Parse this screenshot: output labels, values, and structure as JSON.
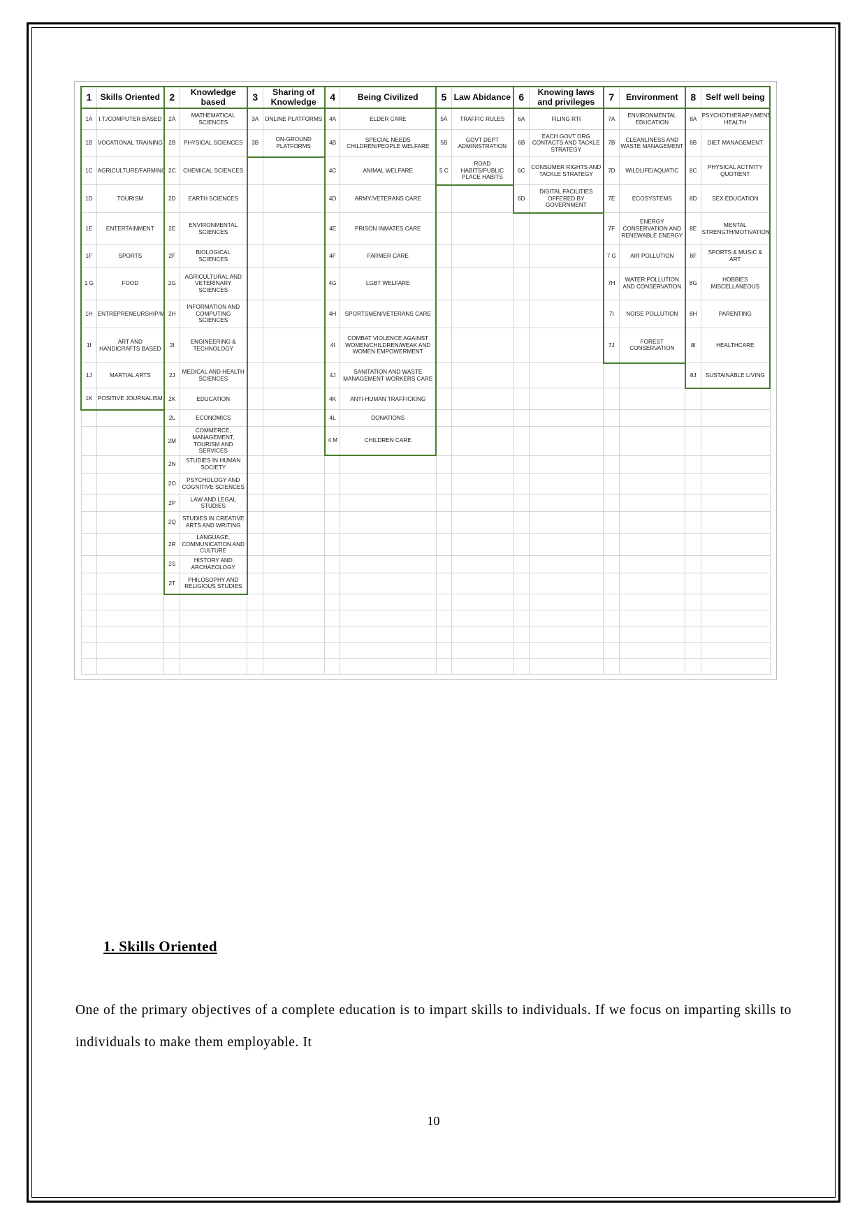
{
  "document": {
    "page_number": "10",
    "section_heading": "1. Skills Oriented",
    "paragraph": "One of the primary objectives of a complete education is to impart skills to individuals. If we focus on imparting skills to individuals to make them employable. It"
  },
  "table": {
    "columns": [
      {
        "number": "1",
        "title": "Skills Oriented",
        "rows": [
          {
            "code": "1A",
            "label": "I.T./COMPUTER BASED"
          },
          {
            "code": "1B",
            "label": "VOCATIONAL TRAINING"
          },
          {
            "code": "1C",
            "label": "AGRICULTURE/FARMING"
          },
          {
            "code": "1D",
            "label": "TOURISM"
          },
          {
            "code": "1E",
            "label": "ENTERTAINMENT"
          },
          {
            "code": "1F",
            "label": "SPORTS"
          },
          {
            "code": "1 G",
            "label": "FOOD"
          },
          {
            "code": "1H",
            "label": "ENTREPRENEURSHIP/MANAGEMENT"
          },
          {
            "code": "1I",
            "label": "ART AND HANDICRAFTS BASED"
          },
          {
            "code": "1J",
            "label": "MARTIAL ARTS"
          },
          {
            "code": "1K",
            "label": "POSITIVE JOURNALISM"
          }
        ]
      },
      {
        "number": "2",
        "title": "Knowledge based",
        "rows": [
          {
            "code": "2A",
            "label": "MATHEMATICAL SCIENCES"
          },
          {
            "code": "2B",
            "label": "PHYSICAL SCIENCES"
          },
          {
            "code": "2C",
            "label": "CHEMICAL SCIENCES"
          },
          {
            "code": "2D",
            "label": "EARTH SCIENCES"
          },
          {
            "code": "2E",
            "label": "ENVIRONMENTAL SCIENCES"
          },
          {
            "code": "2F",
            "label": "BIOLOGICAL SCIENCES"
          },
          {
            "code": "2G",
            "label": "AGRICULTURAL AND VETERINARY SCIENCES"
          },
          {
            "code": "2H",
            "label": "INFORMATION AND COMPUTING SCIENCES"
          },
          {
            "code": "2I",
            "label": "ENGINEERING & TECHNOLOGY"
          },
          {
            "code": "2J",
            "label": "MEDICAL AND HEALTH SCIENCES"
          },
          {
            "code": "2K",
            "label": "EDUCATION"
          },
          {
            "code": "2L",
            "label": "ECONOMICS"
          },
          {
            "code": "2M",
            "label": "COMMERCE, MANAGEMENT, TOURISM AND SERVICES"
          },
          {
            "code": "2N",
            "label": "STUDIES IN HUMAN SOCIETY"
          },
          {
            "code": "2O",
            "label": "PSYCHOLOGY AND COGNITIVE SCIENCES"
          },
          {
            "code": "2P",
            "label": "LAW AND LEGAL STUDIES"
          },
          {
            "code": "2Q",
            "label": "STUDIES IN CREATIVE ARTS AND WRITING"
          },
          {
            "code": "2R",
            "label": "LANGUAGE, COMMUNICATION AND CULTURE"
          },
          {
            "code": "2S",
            "label": "HISTORY AND ARCHAEOLOGY"
          },
          {
            "code": "2T",
            "label": "PHILOSOPHY AND RELIGIOUS STUDIES"
          }
        ]
      },
      {
        "number": "3",
        "title": "Sharing of Knowledge",
        "rows": [
          {
            "code": "3A",
            "label": "ONLINE PLATFORMS"
          },
          {
            "code": "3B",
            "label": "ON-GROUND PLATFORMS"
          }
        ]
      },
      {
        "number": "4",
        "title": "Being Civilized",
        "rows": [
          {
            "code": "4A",
            "label": "ELDER CARE"
          },
          {
            "code": "4B",
            "label": "SPECIAL NEEDS CHILDREN/PEOPLE WELFARE"
          },
          {
            "code": "4C",
            "label": "ANIMAL WELFARE"
          },
          {
            "code": "4D",
            "label": "ARMY/VETERANS CARE"
          },
          {
            "code": "4E",
            "label": "PRISON INMATES CARE"
          },
          {
            "code": "4F",
            "label": "FARMER CARE"
          },
          {
            "code": "4G",
            "label": "LGBT WELFARE"
          },
          {
            "code": "4H",
            "label": "SPORTSMEN/VETERANS CARE"
          },
          {
            "code": "4I",
            "label": "COMBAT VIOLENCE AGAINST WOMEN/CHILDREN/WEAK AND WOMEN EMPOWERMENT"
          },
          {
            "code": "4J",
            "label": "SANITATION AND WASTE MANAGEMENT WORKERS CARE"
          },
          {
            "code": "4K",
            "label": "ANTI-HUMAN TRAFFICKING"
          },
          {
            "code": "4L",
            "label": "DONATIONS"
          },
          {
            "code": "4 M",
            "label": "CHILDREN CARE"
          }
        ]
      },
      {
        "number": "5",
        "title": "Law Abidance",
        "rows": [
          {
            "code": "5A",
            "label": "TRAFFIC RULES"
          },
          {
            "code": "5B",
            "label": "GOVT DEPT ADMINISTRATION"
          },
          {
            "code": "5 C",
            "label": "ROAD HABITS/PUBLIC PLACE HABITS"
          }
        ]
      },
      {
        "number": "6",
        "title": "Knowing laws and privileges",
        "rows": [
          {
            "code": "6A",
            "label": "FILING RTI"
          },
          {
            "code": "6B",
            "label": "EACH GOVT ORG CONTACTS AND TACKLE STRATEGY"
          },
          {
            "code": "6C",
            "label": "CONSUMER RIGHTS AND TACKLE STRATEGY"
          },
          {
            "code": "6D",
            "label": "DIGITAL FACILITIES OFFERED BY GOVERNMENT"
          }
        ]
      },
      {
        "number": "7",
        "title": "Environment",
        "rows": [
          {
            "code": "7A",
            "label": "ENVIRONMENTAL EDUCATION"
          },
          {
            "code": "7B",
            "label": "CLEANLINESS AND WASTE MANAGEMENT"
          },
          {
            "code": "7D",
            "label": "WILDLIFE/AQUATIC"
          },
          {
            "code": "7E",
            "label": "ECOSYSTEMS"
          },
          {
            "code": "7F",
            "label": "ENERGY CONSERVATION AND RENEWABLE ENERGY"
          },
          {
            "code": "7 G",
            "label": "AIR POLLUTION"
          },
          {
            "code": "7H",
            "label": "WATER POLLUTION AND CONSERVATION"
          },
          {
            "code": "7I",
            "label": "NOISE POLLUTION"
          },
          {
            "code": "7J",
            "label": "FOREST CONSERVATION"
          }
        ]
      },
      {
        "number": "8",
        "title": "Self well being",
        "rows": [
          {
            "code": "8A",
            "label": "PSYCHOTHERAPY/MENTAL HEALTH"
          },
          {
            "code": "8B",
            "label": "DIET MANAGEMENT"
          },
          {
            "code": "8C",
            "label": "PHYSICAL ACTIVITY QUOTIENT"
          },
          {
            "code": "8D",
            "label": "SEX EDUCATION"
          },
          {
            "code": "8E",
            "label": "MENTAL STRENGTH/MOTIVATION/INSPIRATION"
          },
          {
            "code": "8F",
            "label": "SPORTS & MUSIC & ART"
          },
          {
            "code": "8G",
            "label": "HOBBIES MISCELLANEOUS"
          },
          {
            "code": "8H",
            "label": "PARENTING"
          },
          {
            "code": "8I",
            "label": "HEALTHCARE"
          },
          {
            "code": "8J",
            "label": "SUSTAINABLE LIVING"
          }
        ]
      }
    ],
    "grid": {
      "total_rows": 26,
      "accent_color": "#4a7c2f",
      "grid_line_color": "#d4d4d4"
    }
  }
}
